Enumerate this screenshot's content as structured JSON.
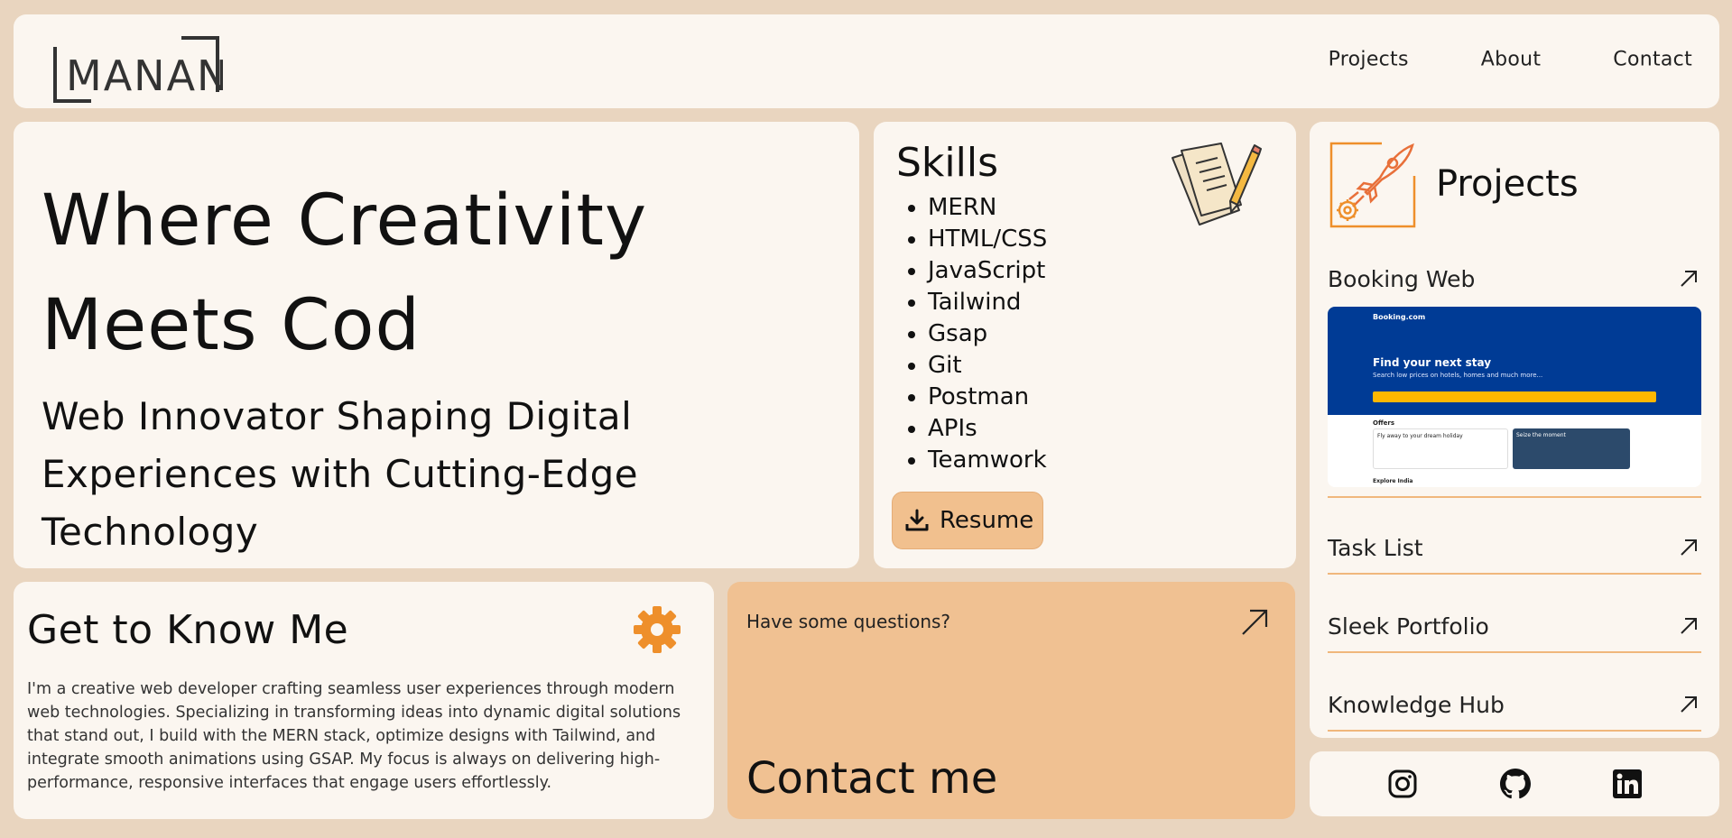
{
  "nav": {
    "logo_text": "MANAN",
    "links": [
      "Projects",
      "About",
      "Contact"
    ]
  },
  "hero": {
    "title": "Where Creativity Meets Cod",
    "subtitle": "Web Innovator Shaping Digital Experiences with Cutting-Edge Technology"
  },
  "skills": {
    "title": "Skills",
    "items": [
      "MERN",
      "HTML/CSS",
      "JavaScript",
      "Tailwind",
      "Gsap",
      "Git",
      "Postman",
      "APIs",
      "Teamwork"
    ],
    "resume_label": "Resume"
  },
  "projects": {
    "title": "Projects",
    "items": [
      {
        "name": "Booking Web"
      },
      {
        "name": "Task List"
      },
      {
        "name": "Sleek Portfolio"
      },
      {
        "name": "Knowledge Hub"
      }
    ],
    "booking_preview": {
      "brand": "Booking.com",
      "headline": "Find your next stay",
      "tagline": "Search low prices on hotels, homes and much more...",
      "offers": "Offers",
      "card1": "Fly away to your dream holiday",
      "card2": "Seize the moment",
      "explore": "Explore India"
    }
  },
  "about": {
    "title": "Get to Know Me",
    "text": "I'm a creative web developer crafting seamless user experiences through modern web technologies. Specializing in transforming ideas into dynamic digital solutions that stand out, I build with the MERN stack, optimize designs with Tailwind, and integrate smooth animations using GSAP. My focus is always on delivering high-performance, responsive interfaces that engage users effortlessly."
  },
  "contact": {
    "question": "Have some questions?",
    "title": "Contact me"
  },
  "social": {
    "icons": [
      "instagram-icon",
      "github-icon",
      "linkedin-icon"
    ]
  },
  "colors": {
    "page_bg": "#e9d5bf",
    "card_bg": "#fbf6f0",
    "accent": "#f0c192",
    "project_line": "#f0b77c",
    "gear": "#ee8f2b"
  }
}
